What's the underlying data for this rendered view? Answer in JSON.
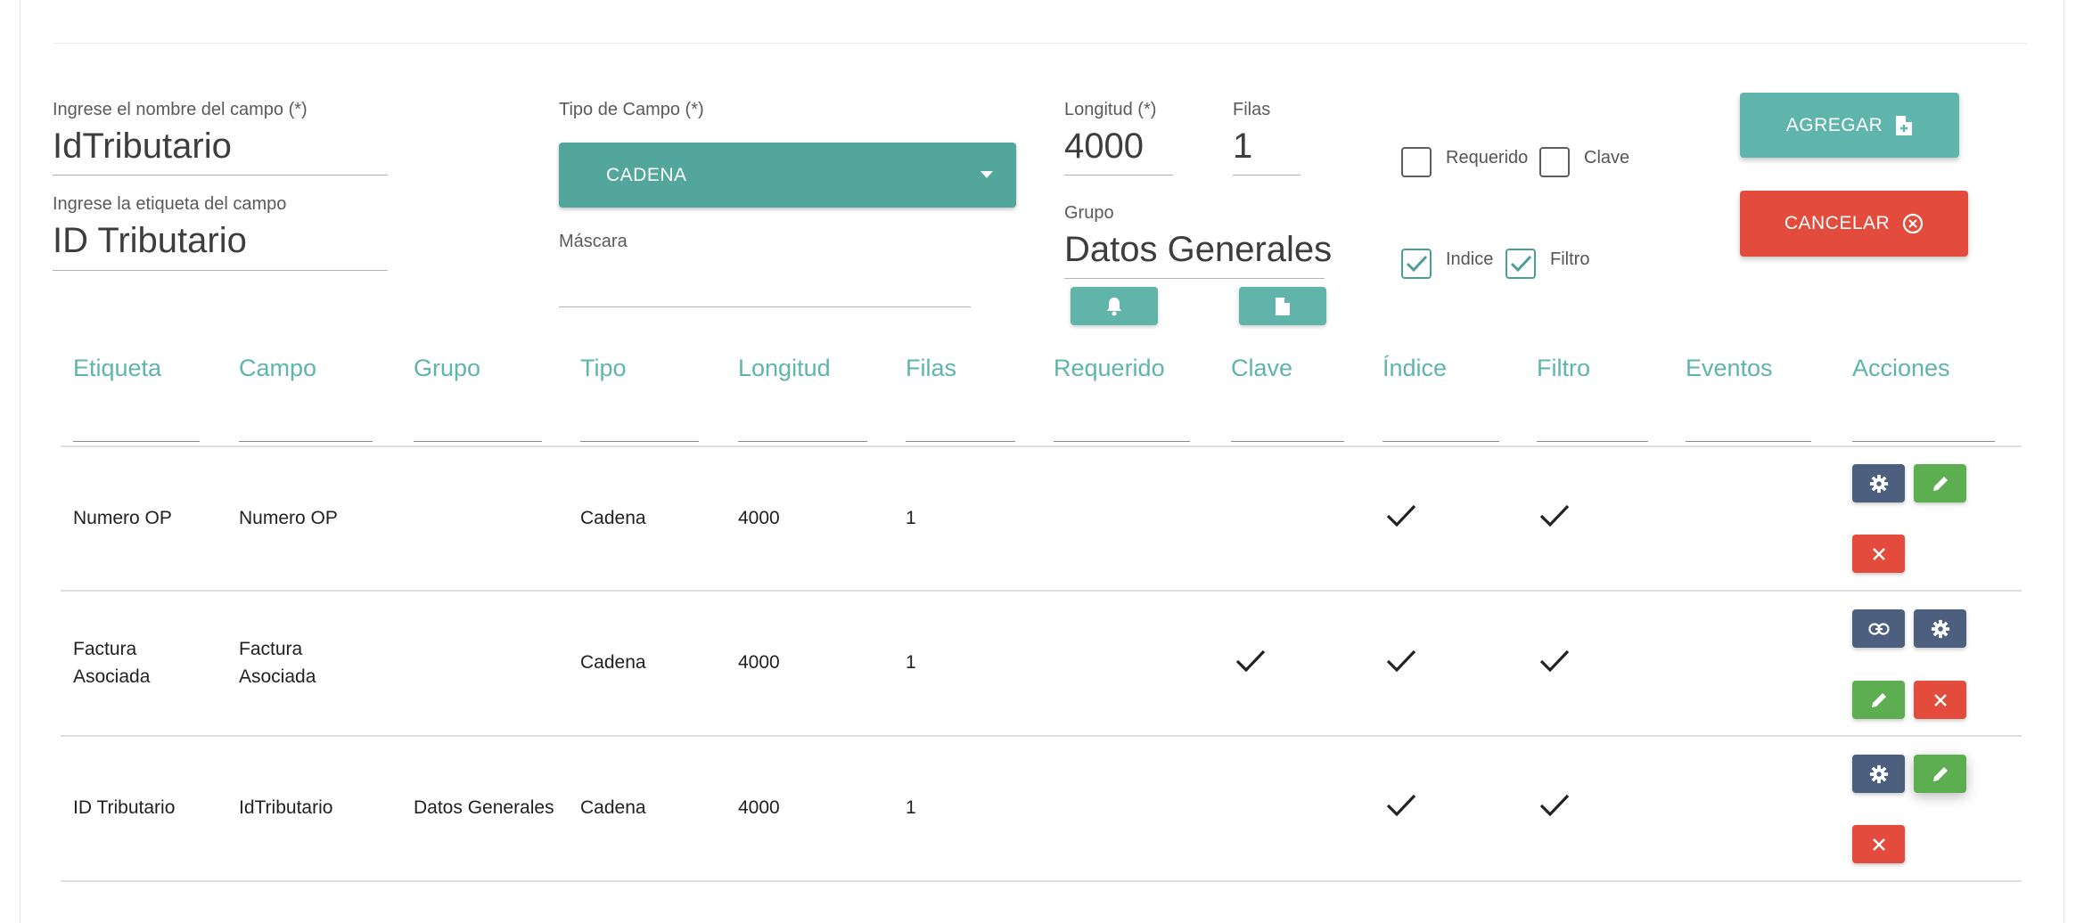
{
  "form": {
    "nombre_label": "Ingrese el nombre del campo (*)",
    "nombre_value": "IdTributario",
    "etiqueta_label": "Ingrese la etiqueta del campo",
    "etiqueta_value": "ID Tributario",
    "tipo_label": "Tipo de Campo (*)",
    "tipo_value": "CADENA",
    "mascara_label": "Máscara",
    "mascara_value": "",
    "longitud_label": "Longitud (*)",
    "longitud_value": "4000",
    "filas_label": "Filas",
    "filas_value": "1",
    "grupo_label": "Grupo",
    "grupo_value": "Datos Generales",
    "checkboxes": {
      "requerido": {
        "label": "Requerido",
        "checked": false
      },
      "clave": {
        "label": "Clave",
        "checked": false
      },
      "indice": {
        "label": "Indice",
        "checked": true
      },
      "filtro": {
        "label": "Filtro",
        "checked": true
      }
    },
    "agregar_label": "AGREGAR",
    "cancelar_label": "CANCELAR"
  },
  "table": {
    "columns": [
      "Etiqueta",
      "Campo",
      "Grupo",
      "Tipo",
      "Longitud",
      "Filas",
      "Requerido",
      "Clave",
      "Índice",
      "Filtro",
      "Eventos",
      "Acciones"
    ],
    "rows": [
      {
        "etiqueta": "Numero OP",
        "campo": "Numero OP",
        "grupo": "",
        "tipo": "Cadena",
        "longitud": "4000",
        "filas": "1",
        "requerido": false,
        "clave": false,
        "indice": true,
        "filtro": true,
        "eventos": ""
      },
      {
        "etiqueta": "Factura Asociada",
        "campo": "Factura Asociada",
        "grupo": "",
        "tipo": "Cadena",
        "longitud": "4000",
        "filas": "1",
        "requerido": false,
        "clave": true,
        "indice": true,
        "filtro": true,
        "eventos": ""
      },
      {
        "etiqueta": "ID Tributario",
        "campo": "IdTributario",
        "grupo": "Datos Generales",
        "tipo": "Cadena",
        "longitud": "4000",
        "filas": "1",
        "requerido": false,
        "clave": false,
        "indice": true,
        "filtro": true,
        "eventos": ""
      }
    ]
  },
  "colors": {
    "teal": "#52a69b",
    "teal_light": "#5fb4ab",
    "red": "#e34c3c",
    "green": "#5cae50",
    "slate": "#4c5f7f"
  },
  "icons": [
    "file-plus-icon",
    "cancel-circle-icon",
    "caret-down-icon",
    "bell-icon",
    "file-icon",
    "check-icon",
    "gear-icon",
    "pencil-icon",
    "close-icon",
    "link-icon"
  ]
}
